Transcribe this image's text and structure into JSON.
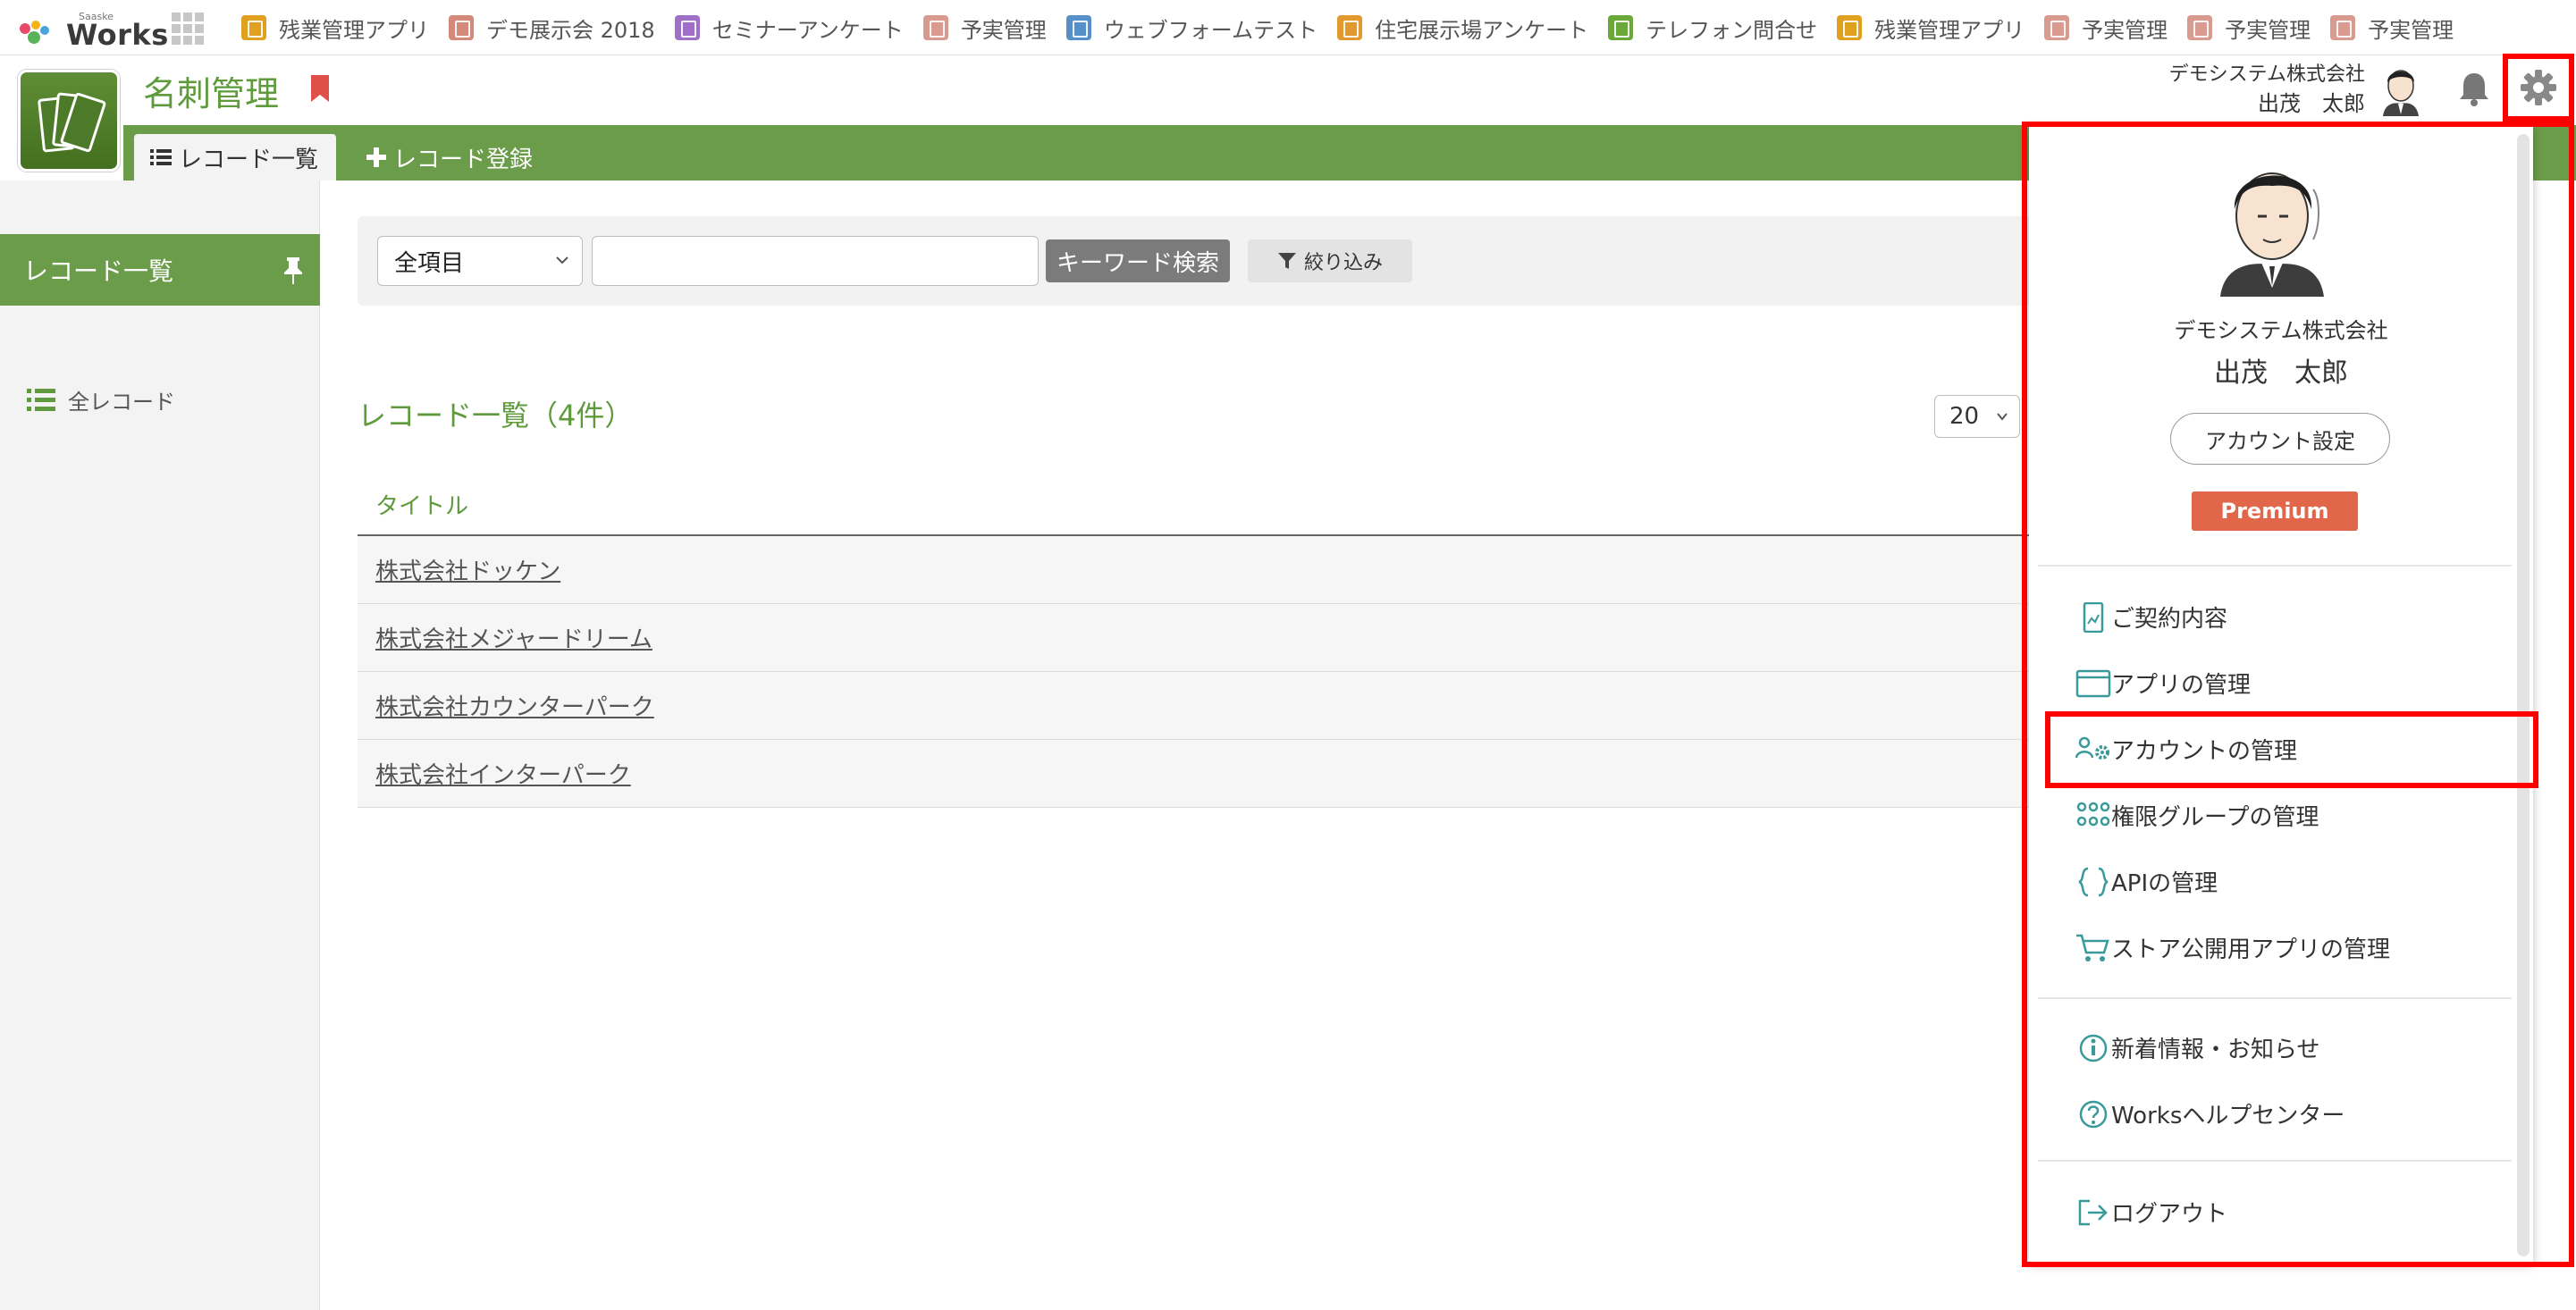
{
  "brand": {
    "small": "Saaske",
    "name": "Works"
  },
  "app_tabs": [
    {
      "label": "残業管理アプリ",
      "color": "#e0a020"
    },
    {
      "label": "デモ展示会 2018",
      "color": "#d48a7a"
    },
    {
      "label": "セミナーアンケート",
      "color": "#a070c8"
    },
    {
      "label": "予実管理",
      "color": "#d99a90"
    },
    {
      "label": "ウェブフォームテスト",
      "color": "#5590c8"
    },
    {
      "label": "住宅展示場アンケート",
      "color": "#e09a30"
    },
    {
      "label": "テレフォン問合せ",
      "color": "#6aa83a"
    },
    {
      "label": "残業管理アプリ",
      "color": "#e0a020"
    },
    {
      "label": "予実管理",
      "color": "#d99a90"
    },
    {
      "label": "予実管理",
      "color": "#d99a90"
    },
    {
      "label": "予実管理",
      "color": "#d99a90"
    }
  ],
  "app": {
    "title": "名刺管理"
  },
  "nav": {
    "list_tab": "レコード一覧",
    "add_tab": "レコード登録"
  },
  "user": {
    "company": "デモシステム株式会社",
    "name": "出茂　太郎"
  },
  "sidebar": {
    "header": "レコード一覧",
    "item": "全レコード"
  },
  "search": {
    "field": "全項目",
    "keyword_button": "キーワード検索",
    "filter_button": "絞り込み"
  },
  "list": {
    "title": "レコード一覧（4件）",
    "per_page": "20",
    "column": "タイトル",
    "rows": [
      "株式会社ドッケン",
      "株式会社メジャードリーム",
      "株式会社カウンターパーク",
      "株式会社インターパーク"
    ]
  },
  "menu": {
    "company": "デモシステム株式会社",
    "name": "出茂　太郎",
    "account_settings": "アカウント設定",
    "plan": "Premium",
    "items": [
      {
        "label": "ご契約内容",
        "icon": "contract-icon"
      },
      {
        "label": "アプリの管理",
        "icon": "window-icon"
      },
      {
        "label": "アカウントの管理",
        "icon": "users-gear-icon"
      },
      {
        "label": "権限グループの管理",
        "icon": "group-icon"
      },
      {
        "label": "APIの管理",
        "icon": "braces-icon"
      },
      {
        "label": "ストア公開用アプリの管理",
        "icon": "cart-icon"
      },
      {
        "label": "新着情報・お知らせ",
        "icon": "info-icon"
      },
      {
        "label": "Worksヘルプセンター",
        "icon": "help-icon"
      },
      {
        "label": "ログアウト",
        "icon": "logout-icon"
      }
    ]
  },
  "colors": {
    "accent_green": "#6b9c4a",
    "title_green": "#5f9a3c",
    "highlight": "#ff0000",
    "premium": "#e2674a",
    "menu_icon": "#3a9a9a"
  }
}
